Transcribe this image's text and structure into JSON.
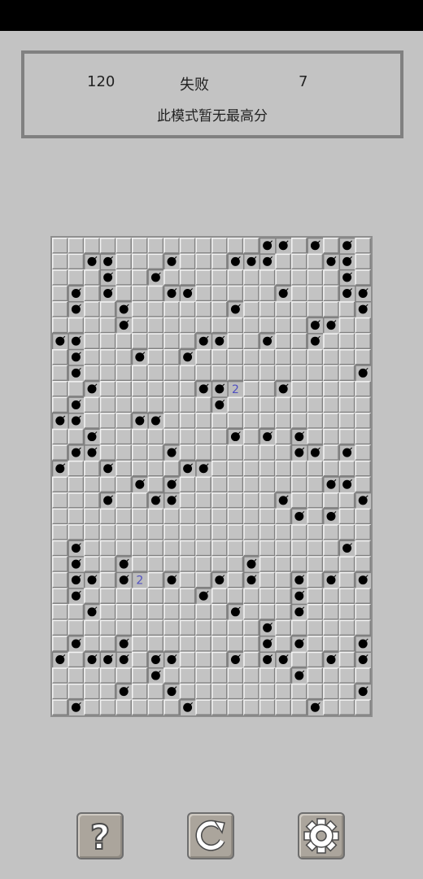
{
  "header": {
    "mines_remaining": "120",
    "status": "失败",
    "elapsed": "7",
    "best_score": "此模式暂无最高分"
  },
  "board": {
    "cols": 20,
    "rows": 30,
    "colors": {
      "covered": "#c3c3c3",
      "revealed": "#bdbdbd",
      "highlight": "#f4f4f4",
      "shadow": "#808080",
      "mine": "#000000",
      "number": "#5050c0"
    },
    "numbers": [
      {
        "row": 9,
        "col": 11,
        "value": "2"
      },
      {
        "row": 21,
        "col": 5,
        "value": "2"
      }
    ],
    "mine_rows": [
      [
        13,
        14,
        16,
        18
      ],
      [
        2,
        3,
        7,
        11,
        12,
        13,
        17,
        18
      ],
      [
        3,
        6,
        18
      ],
      [
        1,
        3,
        7,
        8,
        14,
        18,
        19
      ],
      [
        1,
        4,
        11,
        19
      ],
      [
        4,
        16,
        17
      ],
      [
        0,
        1,
        9,
        10,
        13,
        16
      ],
      [
        1,
        5,
        8
      ],
      [
        1,
        19
      ],
      [
        2,
        9,
        10,
        14
      ],
      [
        1,
        10
      ],
      [
        0,
        1,
        5,
        6
      ],
      [
        2,
        11,
        13,
        15
      ],
      [
        1,
        2,
        7,
        15,
        16,
        18
      ],
      [
        0,
        3,
        8,
        9
      ],
      [
        5,
        7,
        17,
        18
      ],
      [
        3,
        6,
        7,
        14,
        19
      ],
      [
        15,
        17
      ],
      [],
      [
        1,
        18
      ],
      [
        1,
        4,
        12
      ],
      [
        1,
        2,
        4,
        7,
        10,
        12,
        15,
        17,
        19
      ],
      [
        1,
        9,
        15
      ],
      [
        2,
        11,
        15
      ],
      [
        13
      ],
      [
        1,
        4,
        13,
        15,
        19
      ],
      [
        0,
        2,
        3,
        4,
        6,
        7,
        11,
        13,
        14,
        17,
        19
      ],
      [
        6,
        15
      ],
      [
        4,
        7,
        19
      ],
      [
        1,
        8,
        16
      ]
    ]
  },
  "buttons": {
    "help_icon": "question-icon",
    "restart_icon": "restart-icon",
    "settings_icon": "gear-icon"
  }
}
